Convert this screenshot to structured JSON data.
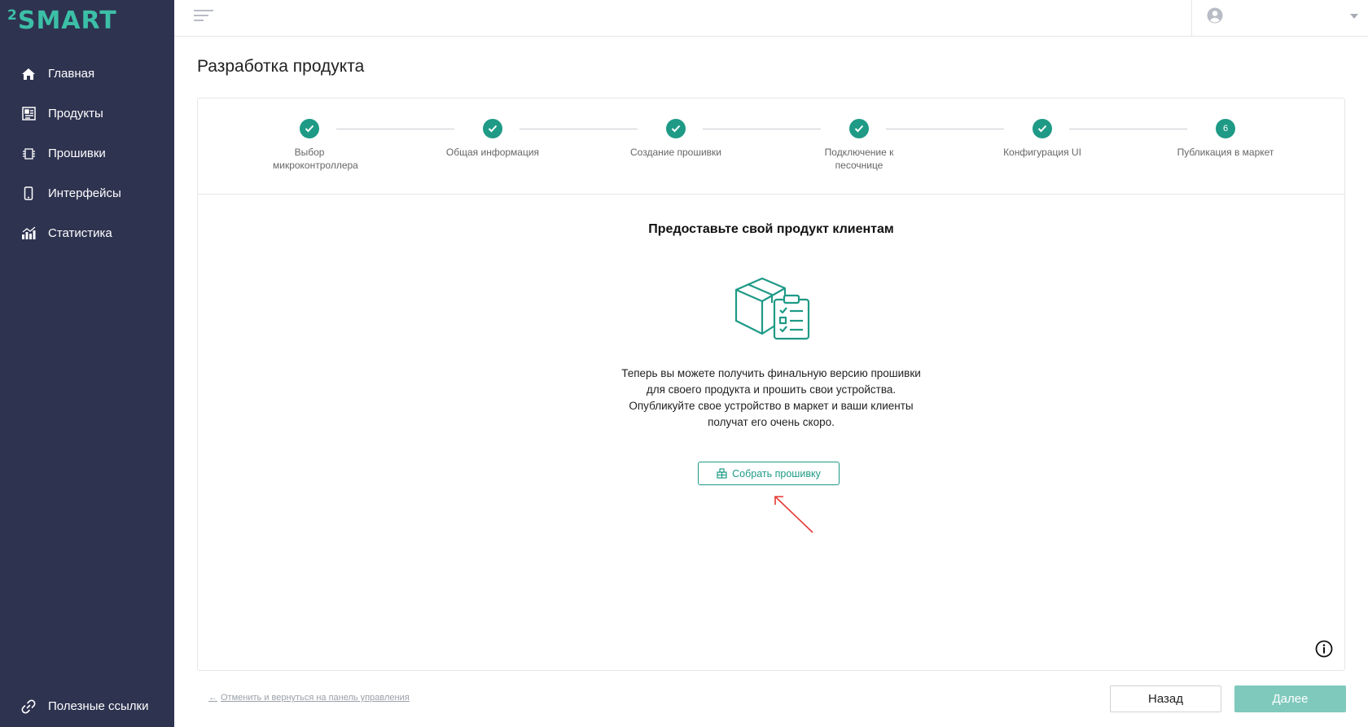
{
  "brand": {
    "logo_sup": "2",
    "logo_text": "SMART"
  },
  "sidebar": {
    "items": [
      {
        "label": "Главная",
        "icon": "home-icon"
      },
      {
        "label": "Продукты",
        "icon": "products-icon"
      },
      {
        "label": "Прошивки",
        "icon": "firmware-icon"
      },
      {
        "label": "Интерфейсы",
        "icon": "phone-icon"
      },
      {
        "label": "Статистика",
        "icon": "statistics-icon"
      }
    ],
    "bottom": {
      "label": "Полезные ссылки",
      "icon": "link-icon"
    }
  },
  "header": {
    "menu_icon": "menu-icon",
    "user_icon": "user-icon"
  },
  "page": {
    "title": "Разработка продукта"
  },
  "stepper": {
    "steps": [
      {
        "label": "Выбор микроконтроллера",
        "state": "done"
      },
      {
        "label": "Общая информация",
        "state": "done"
      },
      {
        "label": "Создание прошивки",
        "state": "done"
      },
      {
        "label": "Подключение к песочнице",
        "state": "done"
      },
      {
        "label": "Конфигурация UI",
        "state": "done"
      },
      {
        "label": "Публикация в маркет",
        "state": "active",
        "number": "6"
      }
    ]
  },
  "content": {
    "title": "Предоставьте свой продукт клиентам",
    "illustration": "box-checklist-icon",
    "lines": [
      "Теперь вы можете получить финальную версию прошивки",
      "для своего продукта и прошить свои устройства.",
      "Опубликуйте свое устройство в маркет и ваши клиенты",
      "получат его очень скоро."
    ],
    "build_button": "Собрать прошивку"
  },
  "footer": {
    "back_link": "Отменить и вернуться на панель управления",
    "back_button": "Назад",
    "next_button": "Далее"
  },
  "colors": {
    "sidebar_bg": "#2e3350",
    "accent": "#1e9a86",
    "logo": "#3cbfa7",
    "next_button_bg": "#7fc9bc",
    "annotation_arrow": "#e53935"
  }
}
